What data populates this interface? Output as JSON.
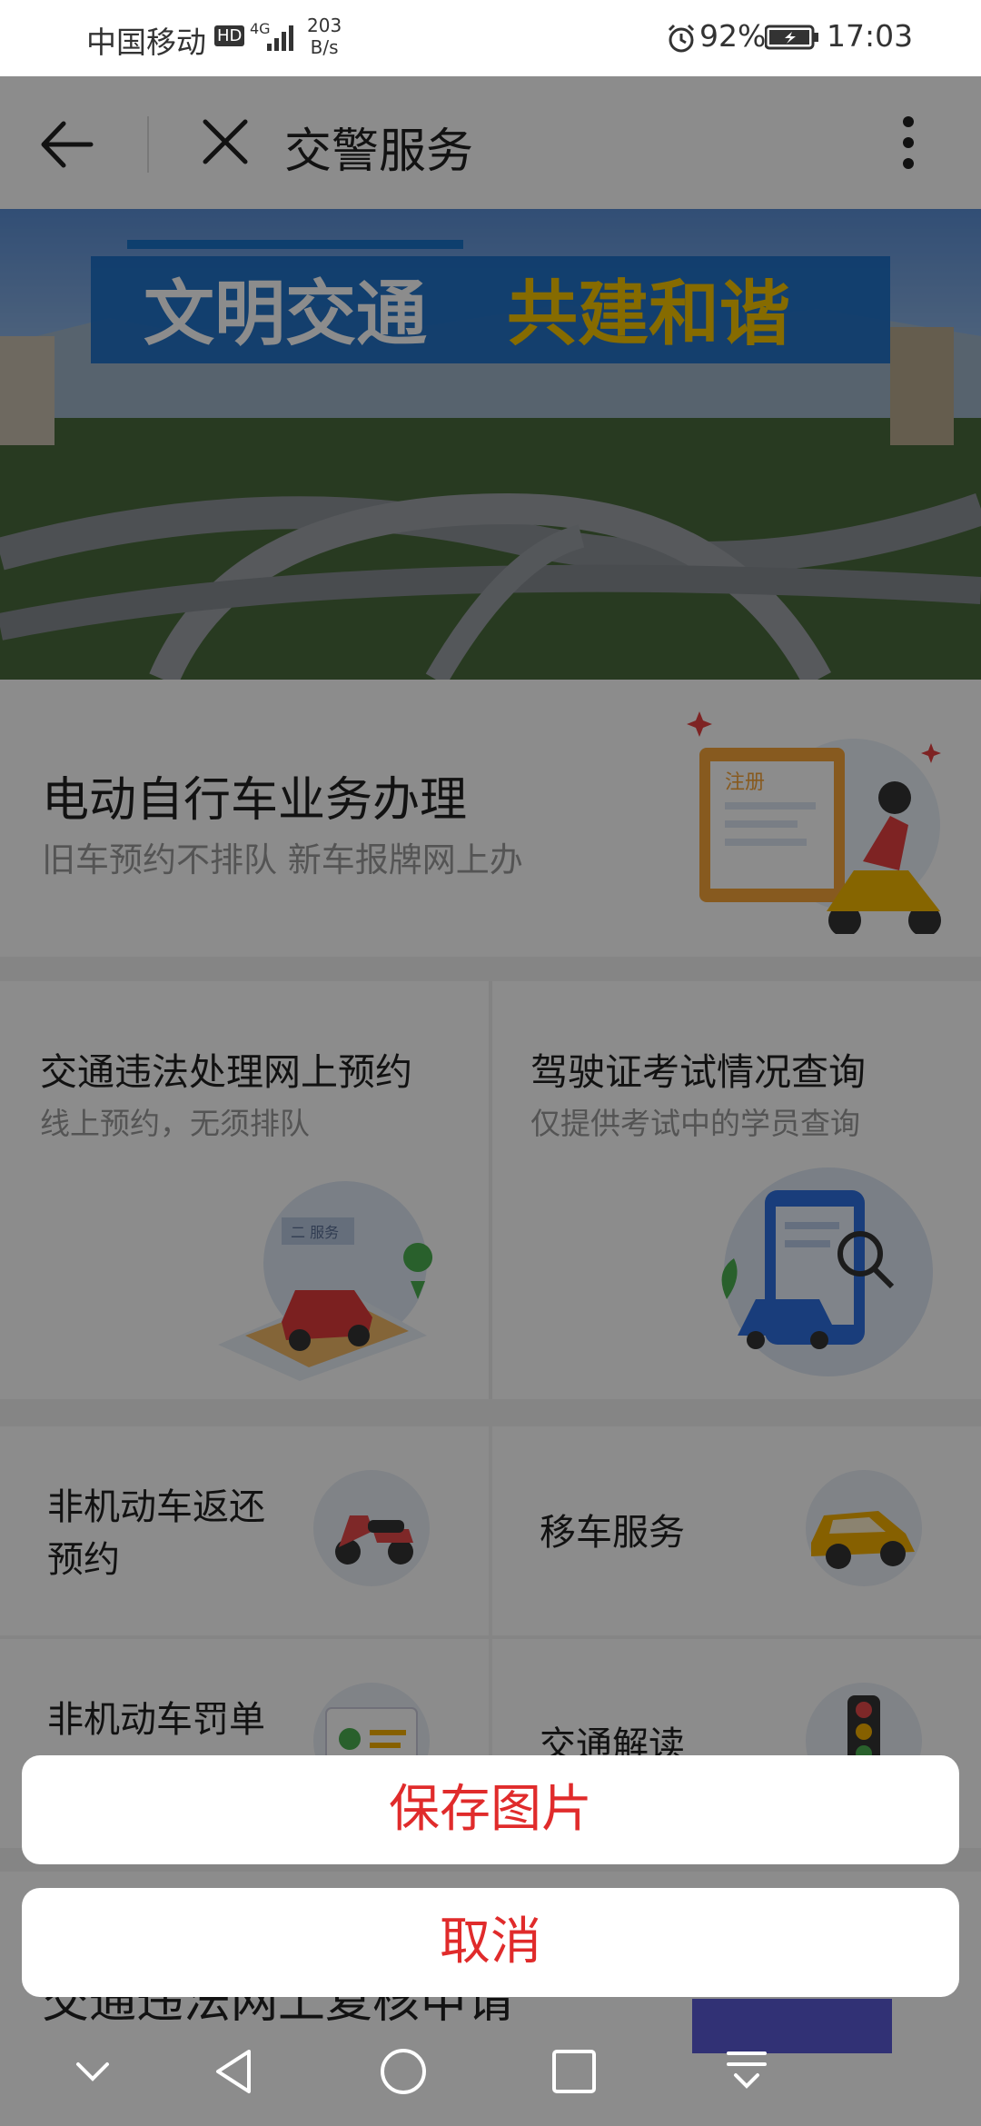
{
  "status_bar": {
    "carrier": "中国移动",
    "hd_badge": "HD",
    "network": "4G",
    "speed_value": "203",
    "speed_unit": "B/s",
    "battery": "92%",
    "time": "17:03",
    "icons": [
      "alarm-icon",
      "battery-icon",
      "signal-icon"
    ]
  },
  "toolbar": {
    "title": "交警服务",
    "icons": [
      "back-arrow-icon",
      "close-icon",
      "more-vertical-icon"
    ]
  },
  "banner": {
    "text_left": "文明交通",
    "text_right": "共建和谐",
    "color_left": "#ffffff",
    "color_right": "#f5c400"
  },
  "card_ebike": {
    "title": "电动自行车业务办理",
    "subtitle": "旧车预约不排队 新车报牌网上办",
    "illustration_text": "注册"
  },
  "cards_row2": [
    {
      "title": "交通违法处理网上预约",
      "subtitle": "线上预约，无须排队",
      "illustration_text": "二 服务"
    },
    {
      "title": "驾驶证考试情况查询",
      "subtitle": "仅提供考试中的学员查询"
    }
  ],
  "tiles": [
    {
      "title_line1": "非机动车返还",
      "title_line2": "预约",
      "icon": "scooter-icon"
    },
    {
      "title_line1": "移车服务",
      "title_line2": "",
      "icon": "car-icon"
    },
    {
      "title_line1": "非机动车罚单",
      "title_line2": "",
      "icon": "ticket-icon"
    },
    {
      "title_line1": "交通解读",
      "title_line2": "",
      "icon": "traffic-light-icon"
    }
  ],
  "partial_bottom_text": "交通违法网上复核申请",
  "action_sheet": {
    "save_label": "保存图片",
    "cancel_label": "取消",
    "accent_color": "#e02b2b"
  },
  "nav_bar": {
    "icons": [
      "hide-nav-icon",
      "back-triangle-icon",
      "home-circle-icon",
      "recents-square-icon",
      "notification-pull-icon"
    ]
  }
}
